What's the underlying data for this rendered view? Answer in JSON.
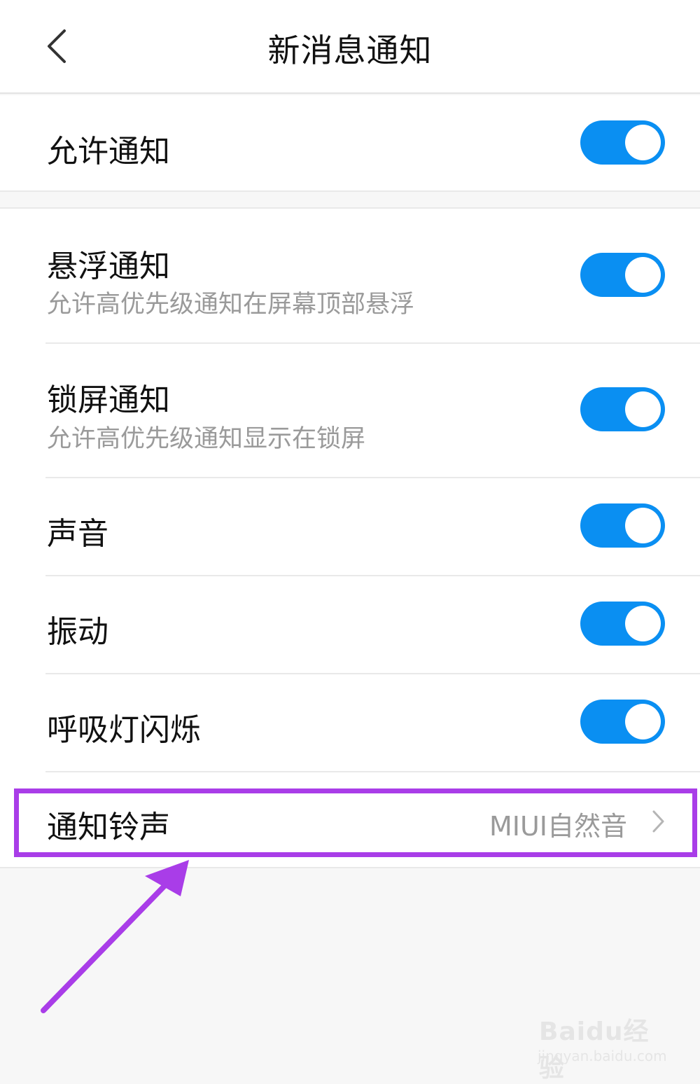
{
  "header": {
    "title": "新消息通知",
    "back_icon": "chevron-left-icon"
  },
  "settings": {
    "allow": {
      "label": "允许通知",
      "enabled": true
    },
    "floating": {
      "label": "悬浮通知",
      "description": "允许高优先级通知在屏幕顶部悬浮",
      "enabled": true
    },
    "lockscreen": {
      "label": "锁屏通知",
      "description": "允许高优先级通知显示在锁屏",
      "enabled": true
    },
    "sound": {
      "label": "声音",
      "enabled": true
    },
    "vibration": {
      "label": "振动",
      "enabled": true
    },
    "led": {
      "label": "呼吸灯闪烁",
      "enabled": true
    },
    "ringtone": {
      "label": "通知铃声",
      "value": "MIUI自然音",
      "icon": "chevron-right-icon"
    }
  },
  "annotation": {
    "highlight_color": "#a93de8",
    "target": "ringtone"
  },
  "colors": {
    "toggle_on": "#0a8ff2",
    "background": "#f7f7f7"
  },
  "watermark": {
    "main": "Baidu经验",
    "sub": "jingyan.baidu.com"
  }
}
